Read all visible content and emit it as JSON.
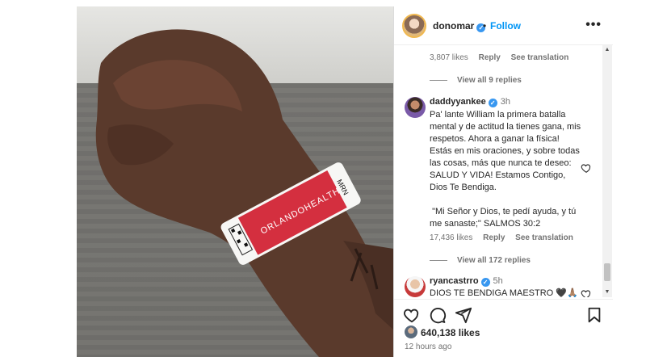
{
  "post": {
    "username": "donomar",
    "follow_label": "Follow",
    "more_label": "•••",
    "separator": "•",
    "photo_band_text": "ORLANDOHEALTH",
    "photo_band_side": "MRN"
  },
  "thread": {
    "top_meta": {
      "likes": "3,807 likes",
      "reply": "Reply",
      "translation": "See translation"
    },
    "top_view_all": "View all 9 replies",
    "comments": [
      {
        "username": "daddyyankee",
        "time": "3h",
        "text": "Pa' lante William la primera batalla mental y de actitud la tienes gana, mis respetos. Ahora a ganar la física! Estás en mis oraciones, y sobre todas las cosas, más que nunca te deseo: SALUD Y VIDA! Estamos Contigo, Dios Te Bendiga.\n\n \"Mi Señor y Dios, te pedí ayuda, y tú me sanaste;\" SALMOS 30:2",
        "likes": "17,436 likes",
        "reply": "Reply",
        "translation": "See translation",
        "view_all": "View all 172 replies"
      },
      {
        "username": "ryancastrro",
        "time": "5h",
        "text": "DIOS TE BENDIGA MAESTRO 🖤🙏🏽"
      }
    ]
  },
  "footer": {
    "likes": "640,138 likes",
    "time_ago": "12 hours ago"
  },
  "icons": [
    "heart-icon",
    "comment-icon",
    "share-icon",
    "bookmark-icon",
    "more-icon",
    "verified-icon"
  ],
  "colors": {
    "accent": "#0095f6",
    "verified": "#3897f0",
    "band": "#d42f3f"
  }
}
